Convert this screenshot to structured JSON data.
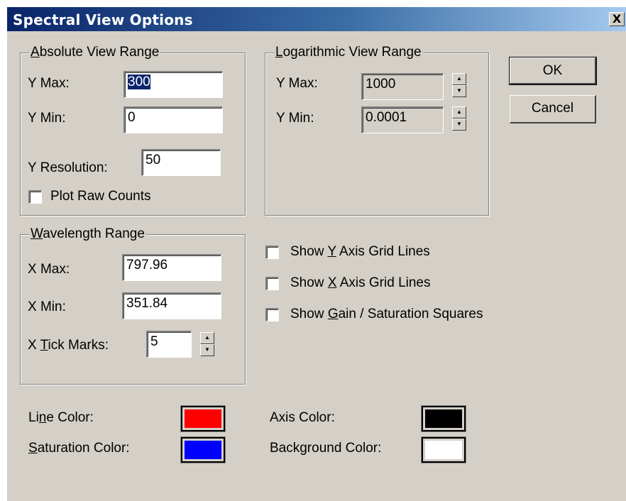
{
  "window": {
    "title": "Spectral View Options",
    "close_label": "X"
  },
  "absolute_view_range": {
    "legend_prefix": "",
    "legend_mnemonic": "A",
    "legend_rest": "bsolute View Range",
    "y_max_label": "Y Max:",
    "y_max_value": "300",
    "y_min_label": "Y Min:",
    "y_min_value": "0",
    "y_resolution_label": "Y Resolution:",
    "y_resolution_value": "50",
    "plot_raw_counts_label": "Plot Raw Counts",
    "plot_raw_counts_checked": false
  },
  "logarithmic_view_range": {
    "legend_mnemonic": "L",
    "legend_rest": "ogarithmic View Range",
    "y_max_label": "Y Max:",
    "y_max_value": "1000",
    "y_min_label": "Y Min:",
    "y_min_value": "0.0001"
  },
  "wavelength_range": {
    "legend_mnemonic": "W",
    "legend_rest": "avelength Range",
    "x_max_label": "X Max:",
    "x_max_value": "797.96",
    "x_min_label": "X Min:",
    "x_min_value": "351.84",
    "x_tick_prefix": "X ",
    "x_tick_mnemonic": "T",
    "x_tick_rest": "ick Marks:",
    "x_tick_value": "5"
  },
  "options": {
    "show_y_grid": {
      "prefix": "Show ",
      "mnemonic": "Y",
      "rest": " Axis Grid Lines",
      "checked": false
    },
    "show_x_grid": {
      "prefix": "Show ",
      "mnemonic": "X",
      "rest": " Axis Grid Lines",
      "checked": false
    },
    "show_gain": {
      "prefix": "Show ",
      "mnemonic": "G",
      "rest": "ain / Saturation Squares",
      "checked": false
    }
  },
  "buttons": {
    "ok_label": "OK",
    "cancel_label": "Cancel"
  },
  "colors": {
    "line_color": {
      "prefix": "Li",
      "mnemonic": "n",
      "rest": "e Color:",
      "value": "#ff0000"
    },
    "saturation_color": {
      "prefix": "",
      "mnemonic": "S",
      "rest": "aturation Color:",
      "value": "#0000ff"
    },
    "axis_color": {
      "label": "Axis Color:",
      "value": "#000000"
    },
    "background_color": {
      "label": "Background Color:",
      "value": "#ffffff"
    }
  }
}
